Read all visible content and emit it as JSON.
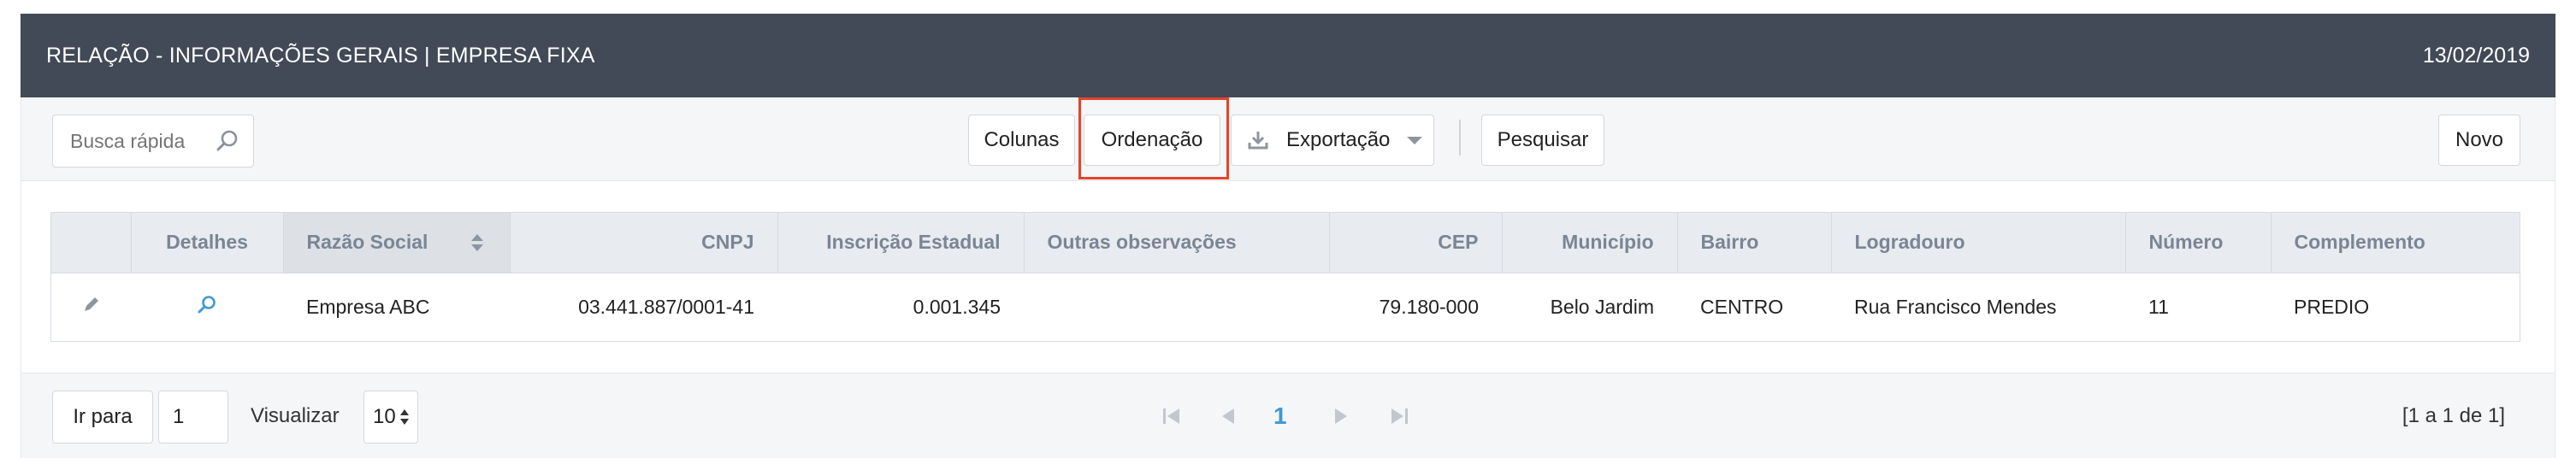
{
  "header": {
    "title": "RELAÇÃO - INFORMAÇÕES GERAIS | EMPRESA FIXA",
    "date": "13/02/2019"
  },
  "toolbar": {
    "search_placeholder": "Busca rápida",
    "colunas_label": "Colunas",
    "ordenacao_label": "Ordenação",
    "exportacao_label": "Exportação",
    "pesquisar_label": "Pesquisar",
    "novo_label": "Novo"
  },
  "table": {
    "columns": [
      "",
      "Detalhes",
      "Razão Social",
      "CNPJ",
      "Inscrição Estadual",
      "Outras observações",
      "CEP",
      "Município",
      "Bairro",
      "Logradouro",
      "Número",
      "Complemento"
    ],
    "rows": [
      {
        "razao_social": "Empresa ABC",
        "cnpj": "03.441.887/0001-41",
        "inscricao_estadual": "0.001.345",
        "outras_observacoes": "",
        "cep": "79.180-000",
        "municipio": "Belo Jardim",
        "bairro": "CENTRO",
        "logradouro": "Rua Francisco Mendes",
        "numero": "11",
        "complemento": "PREDIO"
      }
    ]
  },
  "footer": {
    "ir_para_label": "Ir para",
    "page_input": "1",
    "visualizar_label": "Visualizar",
    "page_size": "10",
    "current_page": "1",
    "record_info": "[1 a 1 de 1]"
  },
  "colors": {
    "header_bg": "#424a57",
    "accent_page": "#3d9ad6",
    "highlight_border": "#e0452d"
  }
}
